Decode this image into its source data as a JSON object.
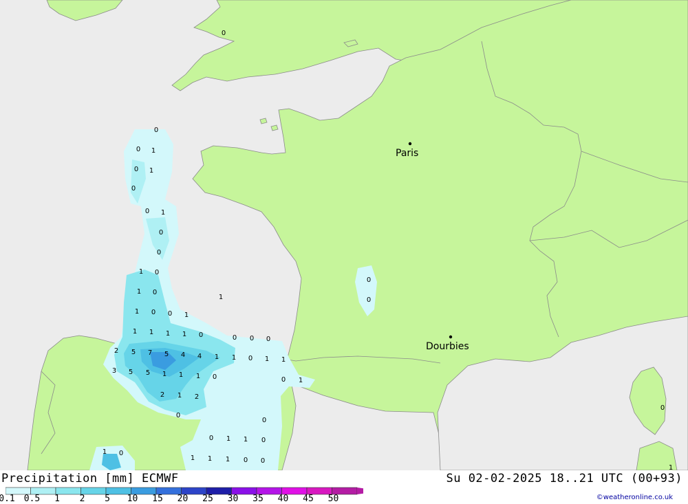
{
  "footer": {
    "title": "Precipitation [mm] ECMWF",
    "datetime": "Su 02-02-2025 18..21 UTC (00+93)",
    "credit": "©weatheronline.co.uk"
  },
  "legend": {
    "labels": [
      "0.1",
      "0.5",
      "1",
      "2",
      "5",
      "10",
      "15",
      "20",
      "25",
      "30",
      "35",
      "40",
      "45",
      "50"
    ],
    "colors": [
      "#d3f8fb",
      "#aff0f4",
      "#8ae6ee",
      "#66d4e8",
      "#4ec0e4",
      "#3a9ce0",
      "#3470dc",
      "#2c44c8",
      "#1e1ea8",
      "#8a10e8",
      "#b414e8",
      "#e010e6",
      "#d818c0",
      "#b41ca4"
    ]
  },
  "map": {
    "colors": {
      "sea": "#ececec",
      "land": "#c6f59b",
      "border": "#8a8a8a"
    },
    "cities": [
      {
        "name": "Paris"
      },
      {
        "name": "Dourbies"
      }
    ],
    "values": [
      "0",
      "0",
      "0",
      "1",
      "0",
      "1",
      "0",
      "0",
      "1",
      "0",
      "0",
      "1",
      "0",
      "1",
      "0",
      "1",
      "1",
      "0",
      "0",
      "1",
      "1",
      "1",
      "1",
      "1",
      "0",
      "0",
      "0",
      "0",
      "2",
      "5",
      "7",
      "5",
      "4",
      "4",
      "1",
      "1",
      "0",
      "1",
      "1",
      "3",
      "5",
      "5",
      "1",
      "1",
      "1",
      "0",
      "0",
      "1",
      "2",
      "1",
      "2",
      "0",
      "0",
      "0",
      "1",
      "1",
      "0",
      "1",
      "0",
      "1",
      "1",
      "1",
      "0",
      "0",
      "0",
      "0",
      "0",
      "1"
    ]
  }
}
